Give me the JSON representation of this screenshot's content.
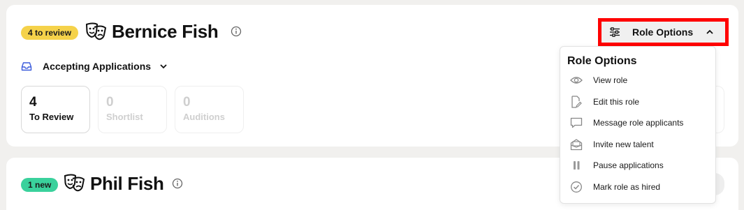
{
  "roles": [
    {
      "badge": "4 to review",
      "name": "Bernice Fish",
      "status": "Accepting Applications",
      "stats": [
        {
          "value": "4",
          "label": "To Review"
        },
        {
          "value": "0",
          "label": "Shortlist"
        },
        {
          "value": "0",
          "label": "Auditions"
        }
      ]
    },
    {
      "badge": "1 new",
      "name": "Phil Fish"
    }
  ],
  "role_options_button": {
    "label": "Role Options"
  },
  "menu": {
    "title": "Role Options",
    "items": [
      {
        "label": "View role",
        "icon": "eye-icon"
      },
      {
        "label": "Edit this role",
        "icon": "edit-document-icon"
      },
      {
        "label": "Message role applicants",
        "icon": "chat-bubble-icon"
      },
      {
        "label": "Invite new talent",
        "icon": "invite-envelope-icon"
      },
      {
        "label": "Pause applications",
        "icon": "pause-icon"
      },
      {
        "label": "Mark role as hired",
        "icon": "check-circle-icon"
      }
    ]
  },
  "colors": {
    "badge_review": "#f5d24a",
    "badge_new": "#3ad19c",
    "highlight_border": "#ff0000",
    "status_icon": "#3b5bdb"
  }
}
